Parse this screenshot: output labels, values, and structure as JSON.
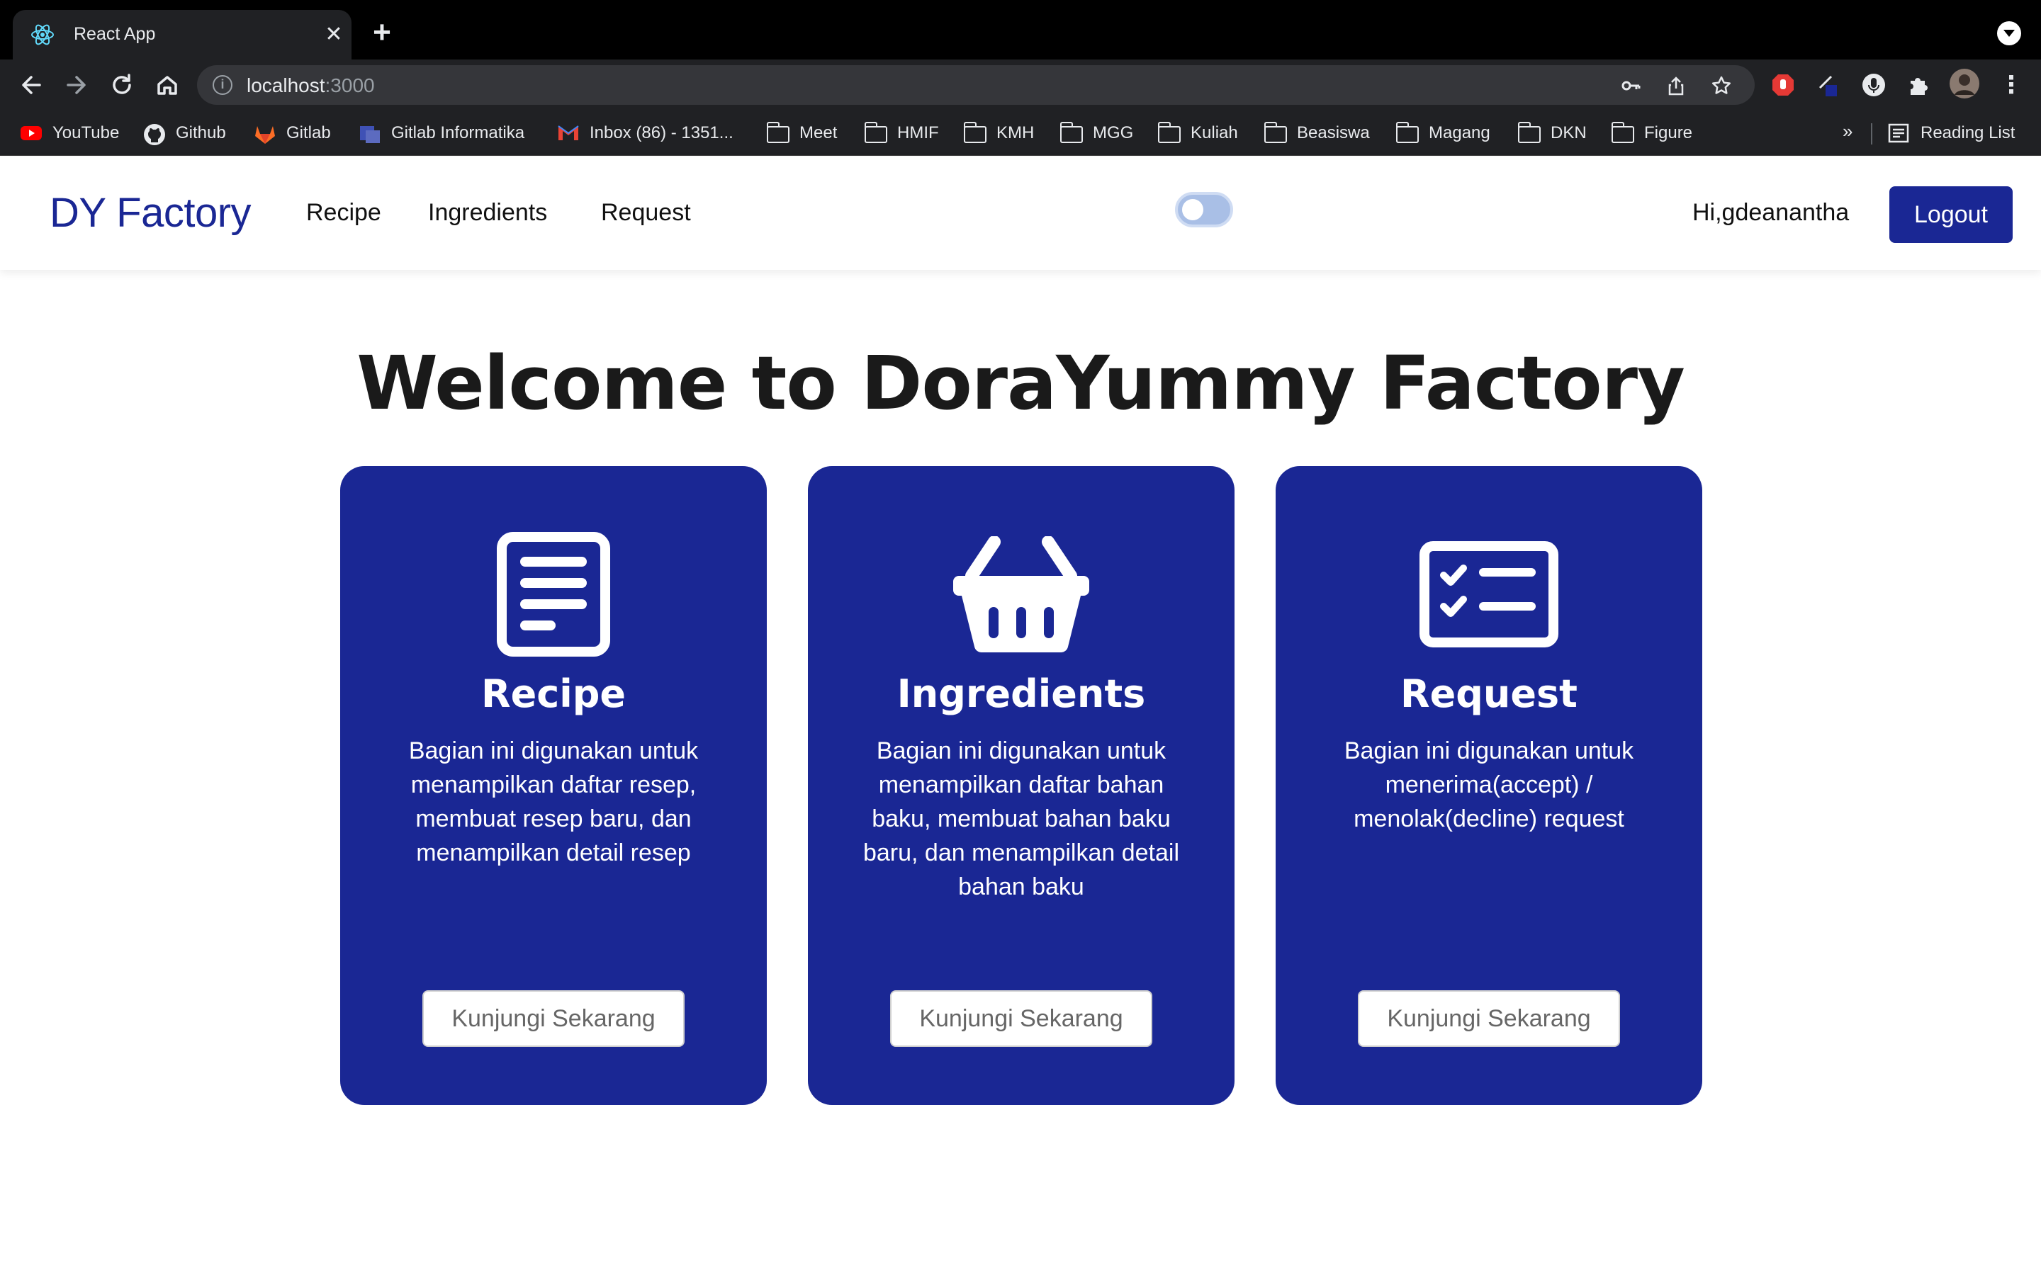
{
  "browser": {
    "tab_title": "React App",
    "url_host": "localhost",
    "url_port": ":3000",
    "bookmarks": [
      {
        "label": "YouTube",
        "icon": "youtube-icon"
      },
      {
        "label": "Github",
        "icon": "github-icon"
      },
      {
        "label": "Gitlab",
        "icon": "gitlab-icon"
      },
      {
        "label": "Gitlab Informatika",
        "icon": "gitlab-informatika-icon"
      },
      {
        "label": "Inbox (86) - 1351...",
        "icon": "gmail-icon"
      },
      {
        "label": "Meet",
        "icon": "folder-icon"
      },
      {
        "label": "HMIF",
        "icon": "folder-icon"
      },
      {
        "label": "KMH",
        "icon": "folder-icon"
      },
      {
        "label": "MGG",
        "icon": "folder-icon"
      },
      {
        "label": "Kuliah",
        "icon": "folder-icon"
      },
      {
        "label": "Beasiswa",
        "icon": "folder-icon"
      },
      {
        "label": "Magang",
        "icon": "folder-icon"
      },
      {
        "label": "DKN",
        "icon": "folder-icon"
      },
      {
        "label": "Figure",
        "icon": "folder-icon"
      }
    ],
    "more_bookmarks": "»",
    "reading_list": "Reading List"
  },
  "navbar": {
    "brand": "DY Factory",
    "links": [
      "Recipe",
      "Ingredients",
      "Request"
    ],
    "greeting": "Hi,gdeanantha",
    "logout_label": "Logout"
  },
  "main": {
    "headline": "Welcome to DoraYummy Factory",
    "cards": [
      {
        "title": "Recipe",
        "icon": "recipe-document-icon",
        "description": "Bagian ini digunakan untuk menampilkan daftar resep, membuat resep baru, dan menampilkan detail resep",
        "button": "Kunjungi Sekarang"
      },
      {
        "title": "Ingredients",
        "icon": "shopping-basket-icon",
        "description": "Bagian ini digunakan untuk menampilkan daftar bahan baku, membuat bahan baku baru, dan menampilkan detail bahan baku",
        "button": "Kunjungi Sekarang"
      },
      {
        "title": "Request",
        "icon": "checklist-icon",
        "description": "Bagian ini digunakan untuk menerima(accept) / menolak(decline) request",
        "button": "Kunjungi Sekarang"
      }
    ]
  },
  "colors": {
    "primary": "#1a2794",
    "chrome_dark": "#202124",
    "toggle": "#a9bfe6"
  }
}
